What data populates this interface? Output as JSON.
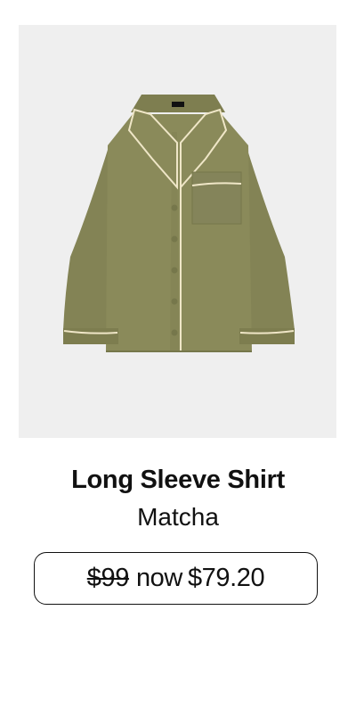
{
  "product": {
    "image_alt": "Long Sleeve Shirt in Matcha",
    "brand_label": "",
    "name": "Long Sleeve Shirt",
    "color": "Matcha",
    "price": {
      "original": "$99",
      "now_label": "now",
      "current": "$79.20"
    }
  },
  "colors": {
    "background": "#ffffff",
    "image_background": "#efefef",
    "fabric": "#8a8a5a",
    "fabric_shadow": "#76774b",
    "piping": "#efe6c7",
    "text": "#111111"
  }
}
